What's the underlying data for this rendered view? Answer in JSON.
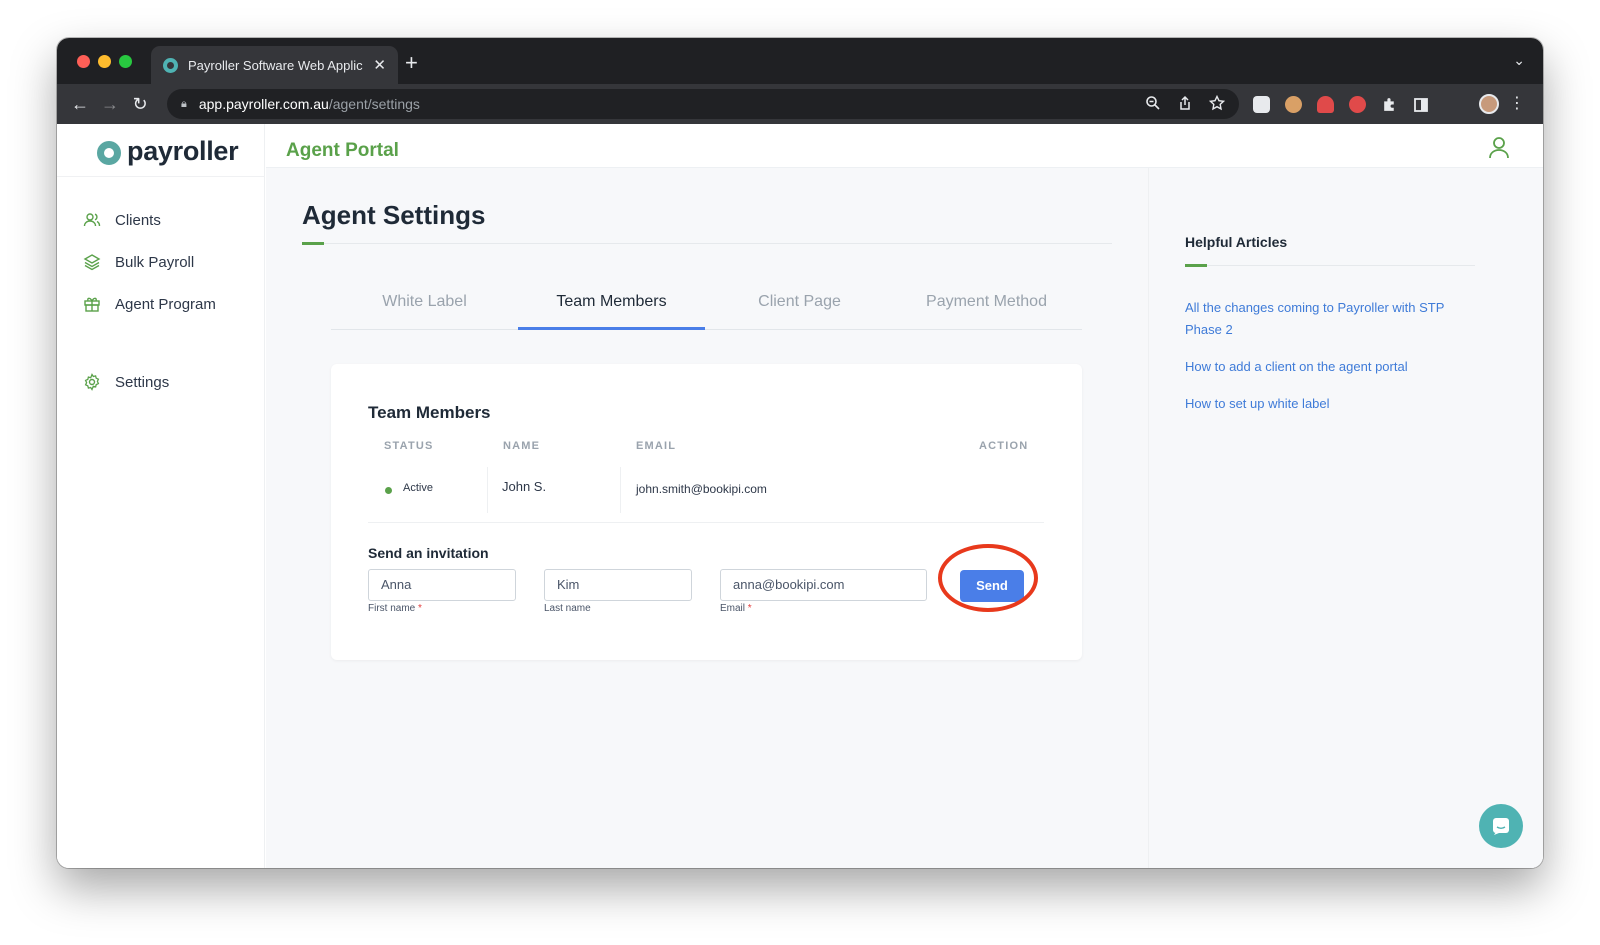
{
  "browser": {
    "tab_title": "Payroller Software Web Applic",
    "url_host": "app.payroller.com.au",
    "url_path": "/agent/settings"
  },
  "sidebar": {
    "logo": "payroller",
    "items": [
      {
        "label": "Clients",
        "icon": "users-icon"
      },
      {
        "label": "Bulk Payroll",
        "icon": "layers-icon"
      },
      {
        "label": "Agent Program",
        "icon": "gift-icon"
      },
      {
        "label": "Settings",
        "icon": "gear-icon"
      }
    ]
  },
  "header": {
    "title": "Agent Portal"
  },
  "page": {
    "title": "Agent Settings",
    "tabs": [
      {
        "label": "White Label",
        "active": false
      },
      {
        "label": "Team Members",
        "active": true
      },
      {
        "label": "Client Page",
        "active": false
      },
      {
        "label": "Payment Method",
        "active": false
      }
    ]
  },
  "team": {
    "title": "Team Members",
    "columns": [
      "STATUS",
      "NAME",
      "EMAIL",
      "ACTION"
    ],
    "rows": [
      {
        "status": "Active",
        "name": "John S.",
        "email": "john.smith@bookipi.com"
      }
    ],
    "invite": {
      "title": "Send an invitation",
      "first_name": "Anna",
      "first_name_label": "First name",
      "last_name": "Kim",
      "last_name_label": "Last name",
      "email": "anna@bookipi.com",
      "email_label": "Email",
      "required_mark": "*",
      "send_label": "Send"
    }
  },
  "help": {
    "title": "Helpful Articles",
    "links": [
      "All the changes coming to Payroller with STP Phase 2",
      "How to add a client on the agent portal",
      "How to set up white label"
    ]
  },
  "colors": {
    "brand_green": "#5aa14a",
    "brand_teal": "#5aa7a2",
    "primary_blue": "#4a7ee8",
    "highlight_red": "#e8391c"
  }
}
